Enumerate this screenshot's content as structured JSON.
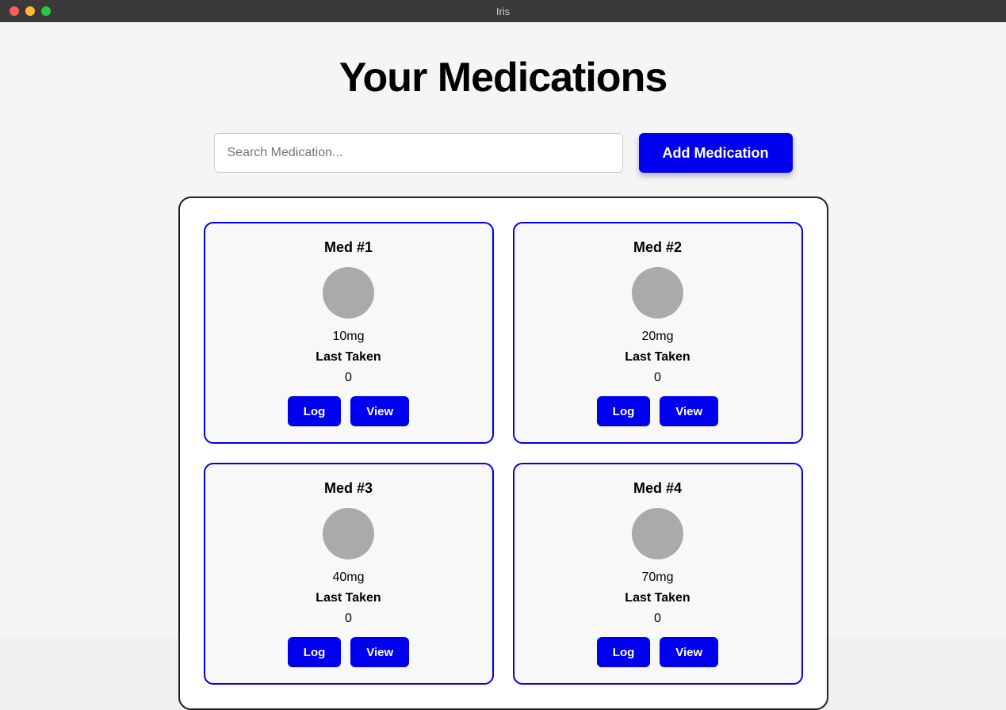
{
  "window": {
    "title": "Iris"
  },
  "page": {
    "title": "Your Medications",
    "search": {
      "placeholder": "Search Medication..."
    },
    "add_button_label": "Add Medication"
  },
  "medications": [
    {
      "id": 1,
      "name": "Med #1",
      "dosage": "10mg",
      "last_taken_label": "Last Taken",
      "last_taken_value": "0",
      "log_label": "Log",
      "view_label": "View"
    },
    {
      "id": 2,
      "name": "Med #2",
      "dosage": "20mg",
      "last_taken_label": "Last Taken",
      "last_taken_value": "0",
      "log_label": "Log",
      "view_label": "View"
    },
    {
      "id": 3,
      "name": "Med #3",
      "dosage": "40mg",
      "last_taken_label": "Last Taken",
      "last_taken_value": "0",
      "log_label": "Log",
      "view_label": "View"
    },
    {
      "id": 4,
      "name": "Med #4",
      "dosage": "70mg",
      "last_taken_label": "Last Taken",
      "last_taken_value": "0",
      "log_label": "Log",
      "view_label": "View"
    }
  ],
  "colors": {
    "accent": "#0000ee",
    "traffic_close": "#ff5f57",
    "traffic_minimize": "#febc2e",
    "traffic_maximize": "#28c840"
  }
}
